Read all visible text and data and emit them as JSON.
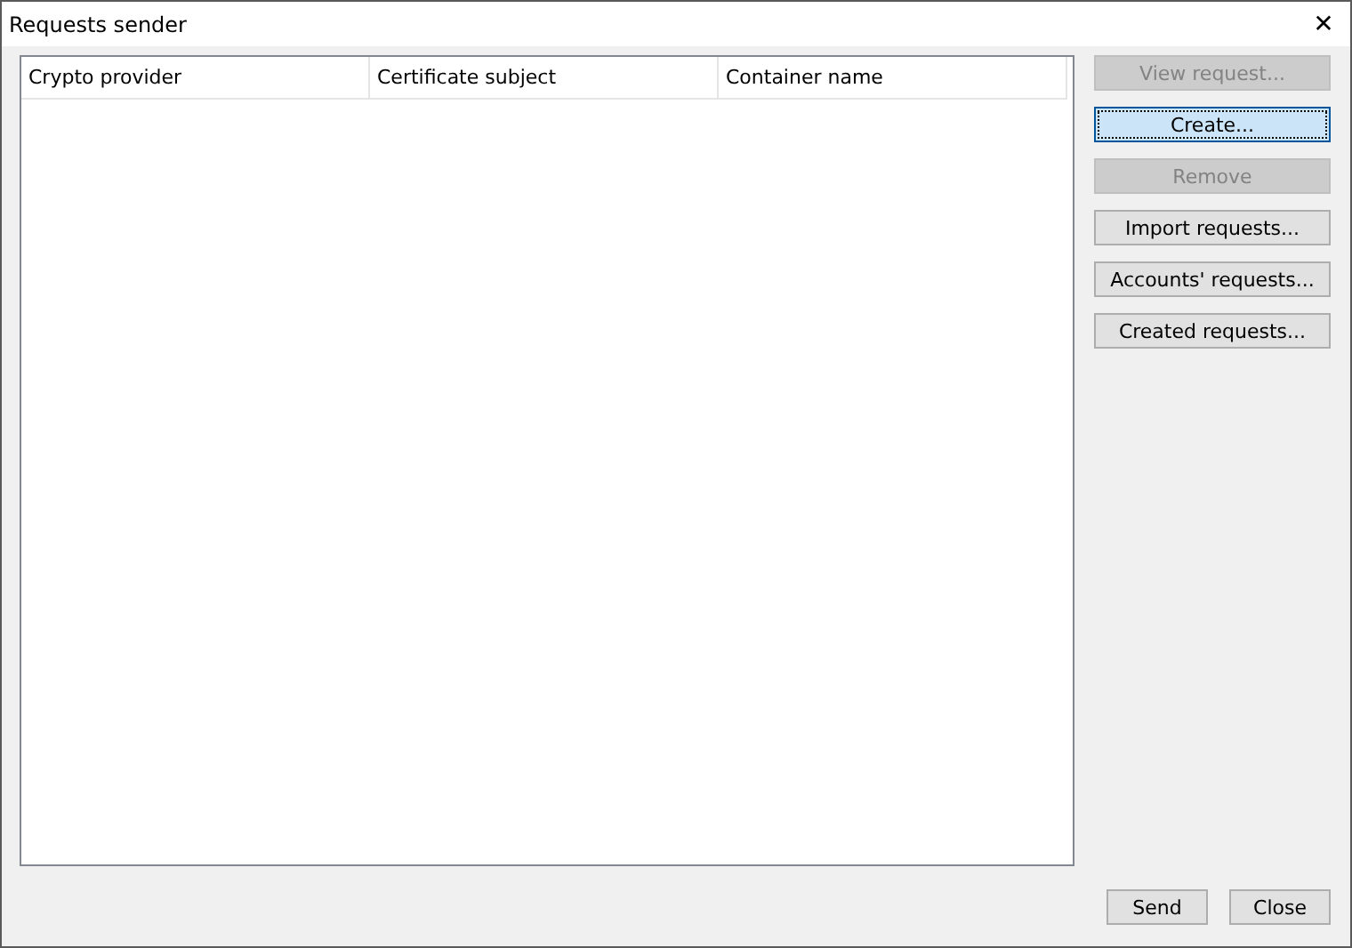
{
  "window": {
    "title": "Requests sender",
    "close_glyph": "✕"
  },
  "table": {
    "columns": [
      "Crypto provider",
      "Certificate subject",
      "Container name"
    ]
  },
  "side_buttons": [
    {
      "label": "View request...",
      "disabled": true,
      "focused": false
    },
    {
      "label": "Create...",
      "disabled": false,
      "focused": true
    },
    {
      "label": "Remove",
      "disabled": true,
      "focused": false
    },
    {
      "label": "Import requests...",
      "disabled": false,
      "focused": false
    },
    {
      "label": "Accounts' requests...",
      "disabled": false,
      "focused": false
    },
    {
      "label": "Created requests...",
      "disabled": false,
      "focused": false
    }
  ],
  "bottom_buttons": [
    {
      "label": "Send"
    },
    {
      "label": "Close"
    }
  ]
}
